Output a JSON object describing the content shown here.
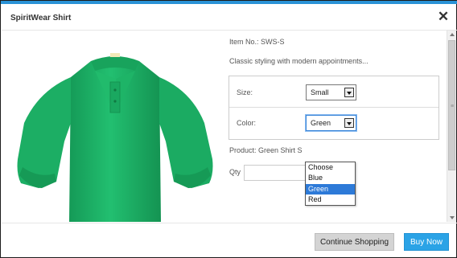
{
  "modal": {
    "title": "SpiritWear Shirt",
    "close_symbol": "✕"
  },
  "product": {
    "item_no": "Item No.: SWS-S",
    "description": "Classic styling with modern appointments...",
    "size_label": "Size:",
    "size_value": "Small",
    "color_label": "Color:",
    "color_value": "Green",
    "product_line": "Product: Green Shirt S",
    "qty_label": "Qty",
    "qty_value": ""
  },
  "color_dropdown": {
    "options": [
      "Choose",
      "Blue",
      "Green",
      "Red"
    ],
    "highlighted": "Green"
  },
  "footer": {
    "continue_label": "Continue Shopping",
    "buy_label": "Buy Now"
  },
  "colors": {
    "accent": "#2ba3e6",
    "top_bar": "#2a92d6",
    "shirt": "#1fb46a",
    "dropdown_highlight": "#2d7ad8"
  }
}
